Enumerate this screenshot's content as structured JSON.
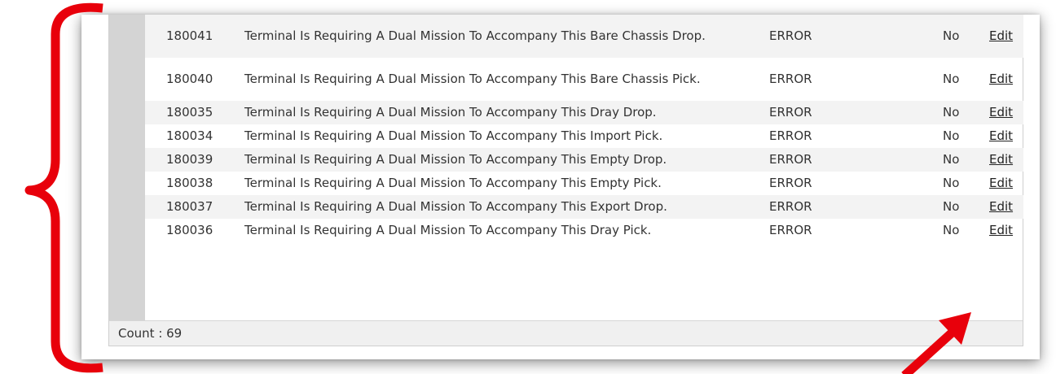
{
  "grid": {
    "rows": [
      {
        "id": "180041",
        "description": "Terminal Is Requiring A Dual Mission To Accompany This Bare Chassis Drop.",
        "level": "ERROR",
        "flag": "No",
        "action": "Edit"
      },
      {
        "id": "180040",
        "description": "Terminal Is Requiring A Dual Mission To Accompany This Bare Chassis Pick.",
        "level": "ERROR",
        "flag": "No",
        "action": "Edit"
      },
      {
        "id": "180035",
        "description": "Terminal Is Requiring A Dual Mission To Accompany This Dray Drop.",
        "level": "ERROR",
        "flag": "No",
        "action": "Edit"
      },
      {
        "id": "180034",
        "description": "Terminal Is Requiring A Dual Mission To Accompany This Import Pick.",
        "level": "ERROR",
        "flag": "No",
        "action": "Edit"
      },
      {
        "id": "180039",
        "description": "Terminal Is Requiring A Dual Mission To Accompany This Empty Drop.",
        "level": "ERROR",
        "flag": "No",
        "action": "Edit"
      },
      {
        "id": "180038",
        "description": "Terminal Is Requiring A Dual Mission To Accompany This Empty Pick.",
        "level": "ERROR",
        "flag": "No",
        "action": "Edit"
      },
      {
        "id": "180037",
        "description": "Terminal Is Requiring A Dual Mission To Accompany This Export Drop.",
        "level": "ERROR",
        "flag": "No",
        "action": "Edit"
      },
      {
        "id": "180036",
        "description": "Terminal Is Requiring A Dual Mission To Accompany This Dray Pick.",
        "level": "ERROR",
        "flag": "No",
        "action": "Edit"
      }
    ],
    "footer": {
      "count_label": "Count : 69"
    }
  },
  "annotations": {
    "brace_icon": "curly-brace-annotation",
    "arrow_icon": "arrow-annotation",
    "color": "#e8000b"
  }
}
